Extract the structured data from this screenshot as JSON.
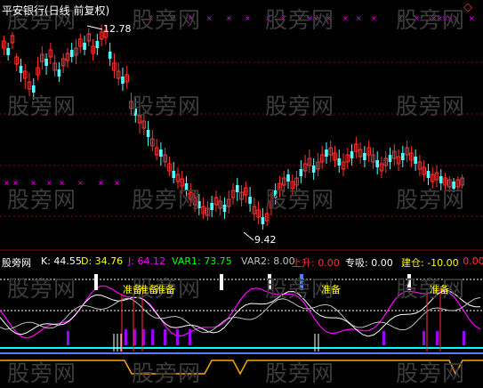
{
  "title": "平安银行(日线 前复权)",
  "watermark": "股旁网",
  "price_high_label": "12.78",
  "price_low_label": "9.42",
  "indicator_header": {
    "name": "股旁网",
    "k": "K: 44.55",
    "d": "D: 34.76",
    "j": "J: 64.12",
    "var1": "VAR1: 73.75",
    "var2": "VAR2: 8.00",
    "shangsheng": "上升: 0.00",
    "zhuanxi": "专吸: 0.00",
    "jiancang": "建仓: -10.00",
    "last": ": 0.00"
  },
  "signal_label": "准备",
  "colors": {
    "up": "#ff3232",
    "down": "#54ffff",
    "grid": "#8b0000",
    "title": "#ffffff",
    "k": "#ffffff",
    "d": "#ffff00",
    "j": "#ff00ff",
    "var1": "#00ff00",
    "var2": "#c0c0c0",
    "shangsheng": "#ff3232",
    "zhuanxi": "#ffffff",
    "jiancang": "#ffff00",
    "cross": "#ff00ff",
    "orange": "#ffa500"
  },
  "chart_data": {
    "type": "candlestick",
    "price_range": [
      9.0,
      13.0
    ],
    "annotations": [
      "12.78",
      "9.42"
    ]
  }
}
